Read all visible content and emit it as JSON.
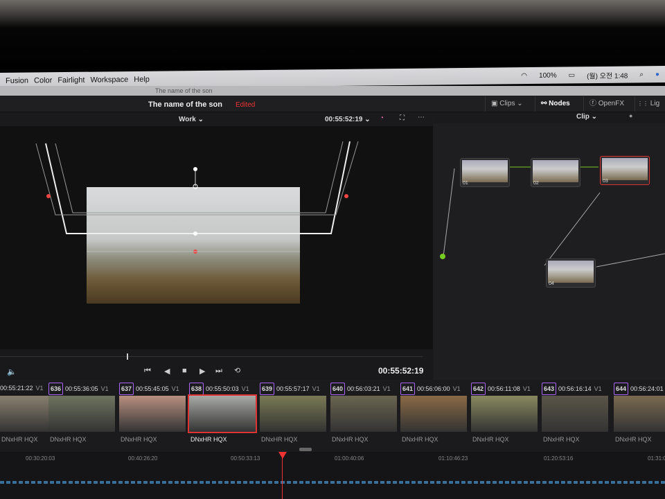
{
  "menubar": {
    "items": [
      "Fusion",
      "Color",
      "Fairlight",
      "Workspace",
      "Help"
    ],
    "battery": "100%",
    "clock": "(월) 오전 1:48"
  },
  "window_title": "The name of the son",
  "header": {
    "project_title": "The name of the son",
    "status": "Edited",
    "tabs": [
      {
        "label": "Clips"
      },
      {
        "label": "Nodes"
      },
      {
        "label": "OpenFX"
      },
      {
        "label": "Lig"
      }
    ]
  },
  "viewer": {
    "view_mode": "Work",
    "timecode": "00:55:52:19",
    "current_timecode": "00:55:52:19"
  },
  "nodes_panel": {
    "mode": "Clip",
    "nodes": [
      {
        "label": "01"
      },
      {
        "label": "02"
      },
      {
        "label": "03"
      },
      {
        "label": "04"
      }
    ]
  },
  "clips": [
    {
      "num": "",
      "tc": "00:55:21:22",
      "track": "V1",
      "codec": "DNxHR HQX",
      "color": "#8a8070"
    },
    {
      "num": "636",
      "tc": "00:55:36:05",
      "track": "V1",
      "codec": "DNxHR HQX",
      "color": "#6f7460"
    },
    {
      "num": "637",
      "tc": "00:55:45:05",
      "track": "V1",
      "codec": "DNxHR HQX",
      "color": "#b89080"
    },
    {
      "num": "638",
      "tc": "00:55:50:03",
      "track": "V1",
      "codec": "DNxHR HQX",
      "color": "#a8aaa6"
    },
    {
      "num": "639",
      "tc": "00:55:57:17",
      "track": "V1",
      "codec": "DNxHR HQX",
      "color": "#7a7a55"
    },
    {
      "num": "640",
      "tc": "00:56:03:21",
      "track": "V1",
      "codec": "DNxHR HQX",
      "color": "#6a6550"
    },
    {
      "num": "641",
      "tc": "00:56:06:00",
      "track": "V1",
      "codec": "DNxHR HQX",
      "color": "#8a6a45"
    },
    {
      "num": "642",
      "tc": "00:56:11:08",
      "track": "V1",
      "codec": "DNxHR HQX",
      "color": "#8a8a60"
    },
    {
      "num": "643",
      "tc": "00:56:16:14",
      "track": "V1",
      "codec": "DNxHR HQX",
      "color": "#5a5548"
    },
    {
      "num": "644",
      "tc": "00:56:24:01",
      "track": "",
      "codec": "DNxHR HQX",
      "color": "#7a6a50"
    }
  ],
  "ruler": [
    "00:30:20:03",
    "00:40:26:20",
    "00:50:33:13",
    "01:00:40:06",
    "01:10:46:23",
    "01:20:53:16",
    "01:31:0"
  ],
  "colors": {
    "accent_red": "#e33333",
    "selection": "#d33333"
  }
}
